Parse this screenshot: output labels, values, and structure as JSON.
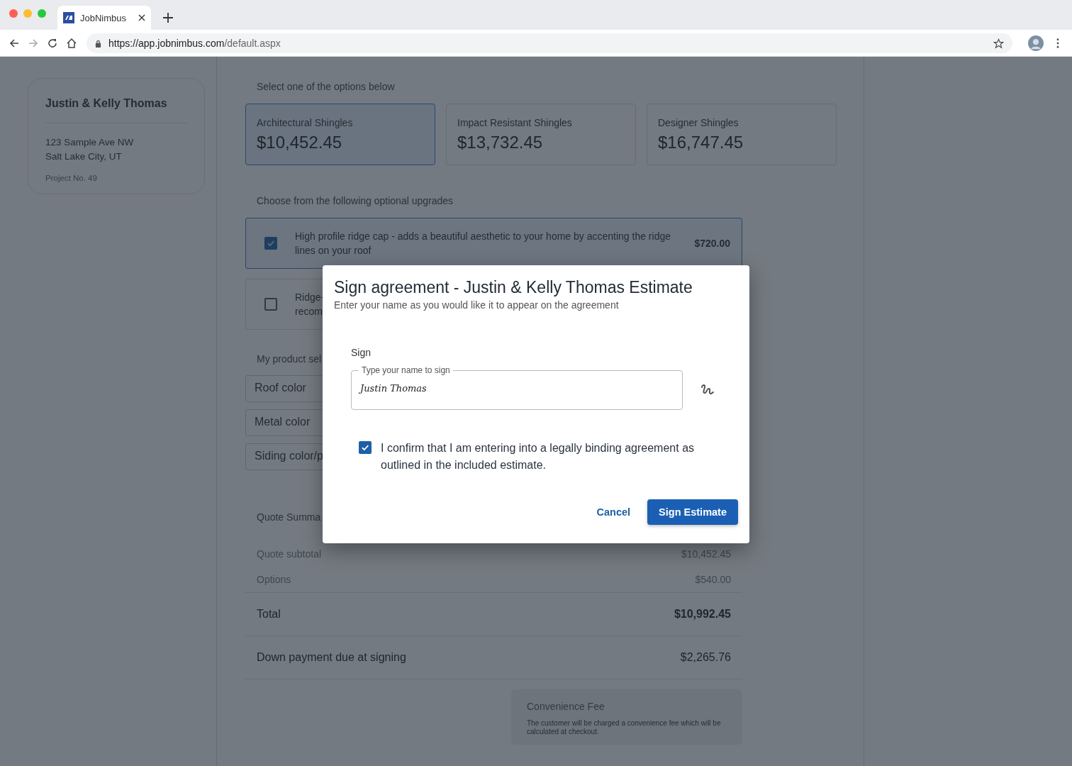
{
  "browser": {
    "tab_title": "JobNimbus",
    "url_host": "https://app.jobnimbus.com",
    "url_path": "/default.aspx"
  },
  "customer": {
    "name": "Justin & Kelly Thomas",
    "address_lines": [
      "123 Sample Ave NW",
      "Salt Lake City, UT"
    ],
    "project": "Project No. 49"
  },
  "options": {
    "title": "Select one of the options below",
    "items": [
      {
        "name": "Architectural Shingles",
        "price": "$10,452.45",
        "selected": true
      },
      {
        "name": "Impact Resistant Shingles",
        "price": "$13,732.45",
        "selected": false
      },
      {
        "name": "Designer Shingles",
        "price": "$16,747.45",
        "selected": false
      }
    ]
  },
  "upgrades": {
    "title": "Choose from the following optional upgrades",
    "items": [
      {
        "text": "High profile ridge cap - adds a beautiful aesthetic to your home by accenting the ridge lines on your roof",
        "price": "$720.00",
        "checked": true
      },
      {
        "text": "Ridge-\nrecom",
        "checked": false
      }
    ]
  },
  "product_selection": {
    "title": "My product sel",
    "fields": [
      {
        "label": "Roof color"
      },
      {
        "label": "Metal color"
      },
      {
        "label": "Siding color/p"
      }
    ]
  },
  "quote_summary": {
    "title": "Quote Summa",
    "rows": [
      {
        "label": "Quote subtotal",
        "value": "$10,452.45",
        "kind": "minor"
      },
      {
        "label": "Options",
        "value": "$540.00",
        "kind": "minor"
      },
      {
        "label": "Total",
        "value": "$10,992.45",
        "kind": "total"
      },
      {
        "label": "Down payment due at signing",
        "value": "$2,265.76",
        "kind": "major"
      }
    ]
  },
  "convenience_fee": {
    "title": "Convenience Fee",
    "text": "The customer will be charged a convenience fee which will be calculated at checkout."
  },
  "dialog": {
    "title": "Sign agreement - Justin & Kelly Thomas Estimate",
    "subtitle": "Enter your name as you would like it to appear on the agreement",
    "section_label": "Sign",
    "field": {
      "label": "Type your name to sign",
      "value": "Justin Thomas"
    },
    "confirm": {
      "text": "I confirm that I am entering into a legally binding agreement as outlined in the included estimate.",
      "checked": true
    },
    "buttons": [
      {
        "label": "Cancel",
        "kind": "text"
      },
      {
        "label": "Sign Estimate",
        "kind": "primary"
      }
    ]
  }
}
